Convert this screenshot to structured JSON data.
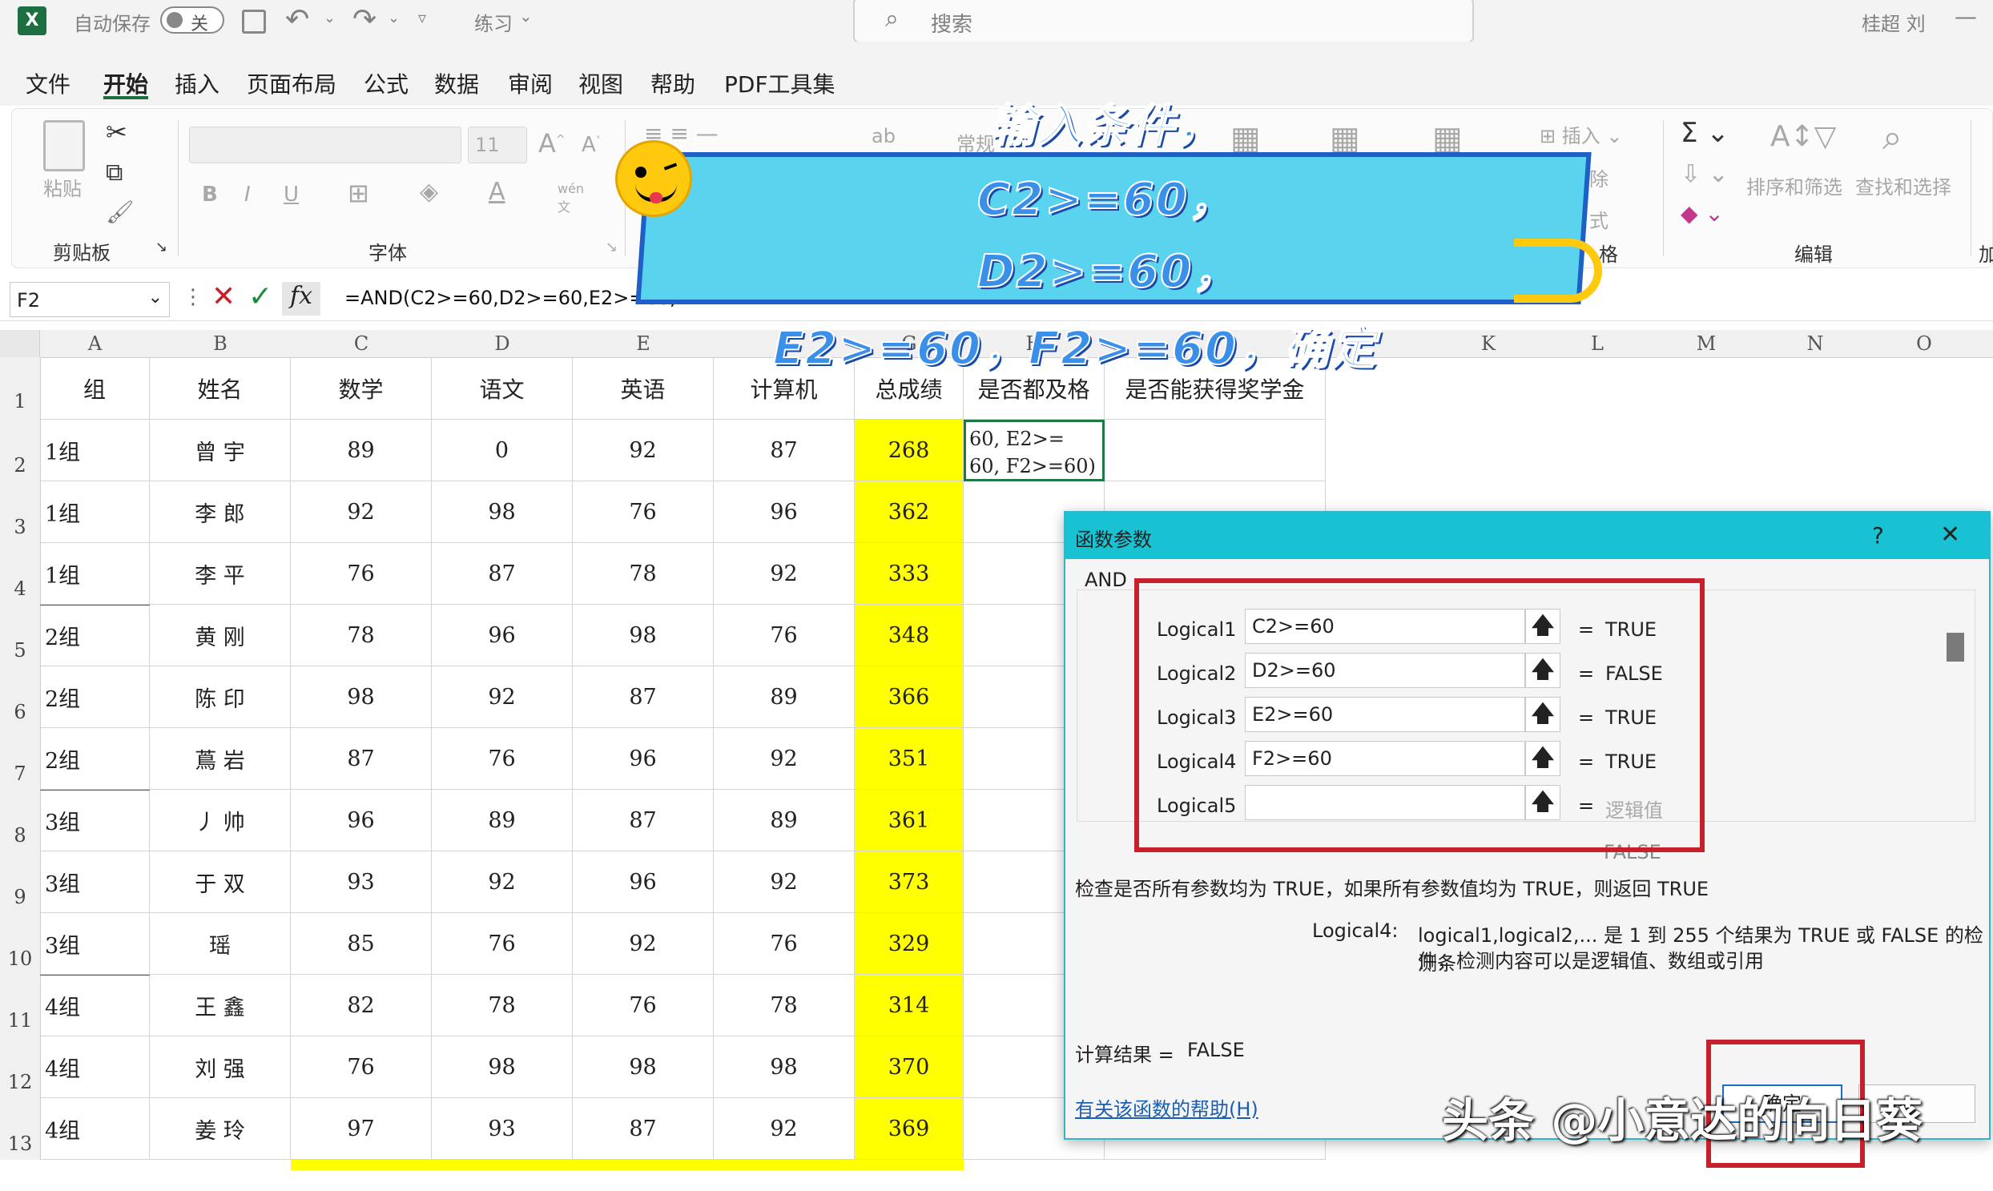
{
  "titlebar": {
    "autosave": "自动保存",
    "toggle": "关",
    "filename": "练习",
    "search_placeholder": "搜索",
    "user": "桂超 刘"
  },
  "menu": [
    "文件",
    "开始",
    "插入",
    "页面布局",
    "公式",
    "数据",
    "审阅",
    "视图",
    "帮助",
    "PDF工具集"
  ],
  "ribbon": {
    "paste": "粘贴",
    "clipboard": "剪贴板",
    "font_size": "11",
    "bold": "B",
    "italic": "I",
    "underline": "U",
    "font_group": "字体",
    "number_format": "常规",
    "insert": "插入",
    "delete": "除",
    "format": "式",
    "cells_group": "格",
    "sort_filter": "排序和筛选",
    "find_select": "查找和选择",
    "edit_group": "编辑",
    "add": "加"
  },
  "formula_bar": {
    "name_box": "F2",
    "fx": "fx",
    "formula": "=AND(C2>=60,D2>=60,E2>=60,"
  },
  "columns": [
    "A",
    "B",
    "C",
    "D",
    "E",
    "F",
    "G",
    "H",
    "I",
    "J",
    "K",
    "L",
    "M",
    "N",
    "O"
  ],
  "header_row": [
    "组",
    "姓名",
    "数学",
    "语文",
    "英语",
    "计算机",
    "总成绩",
    "是否都及格",
    "是否能获得奖学金"
  ],
  "rows": [
    {
      "n": "2",
      "group": "1组",
      "name": "曾 宇",
      "math": "89",
      "chinese": "0",
      "english": "92",
      "cs": "87",
      "total": "268"
    },
    {
      "n": "3",
      "group": "1组",
      "name": "李 郎",
      "math": "92",
      "chinese": "98",
      "english": "76",
      "cs": "96",
      "total": "362"
    },
    {
      "n": "4",
      "group": "1组",
      "name": "李 平",
      "math": "76",
      "chinese": "87",
      "english": "78",
      "cs": "92",
      "total": "333"
    },
    {
      "n": "5",
      "group": "2组",
      "name": "黄 刚",
      "math": "78",
      "chinese": "96",
      "english": "98",
      "cs": "76",
      "total": "348"
    },
    {
      "n": "6",
      "group": "2组",
      "name": "陈 印",
      "math": "98",
      "chinese": "92",
      "english": "87",
      "cs": "89",
      "total": "366"
    },
    {
      "n": "7",
      "group": "2组",
      "name": "蔦 岩",
      "math": "87",
      "chinese": "76",
      "english": "96",
      "cs": "92",
      "total": "351"
    },
    {
      "n": "8",
      "group": "3组",
      "name": "丿 帅",
      "math": "96",
      "chinese": "89",
      "english": "87",
      "cs": "89",
      "total": "361"
    },
    {
      "n": "9",
      "group": "3组",
      "name": "于 双",
      "math": "93",
      "chinese": "92",
      "english": "96",
      "cs": "92",
      "total": "373"
    },
    {
      "n": "10",
      "group": "3组",
      "name": "瑶",
      "math": "85",
      "chinese": "76",
      "english": "92",
      "cs": "76",
      "total": "329"
    },
    {
      "n": "11",
      "group": "4组",
      "name": "王 鑫",
      "math": "82",
      "chinese": "78",
      "english": "76",
      "cs": "78",
      "total": "314"
    },
    {
      "n": "12",
      "group": "4组",
      "name": "刘 强",
      "math": "76",
      "chinese": "98",
      "english": "98",
      "cs": "98",
      "total": "370"
    },
    {
      "n": "13",
      "group": "4组",
      "name": "姜 玲",
      "math": "97",
      "chinese": "93",
      "english": "87",
      "cs": "92",
      "total": "369"
    }
  ],
  "row1_num": "1",
  "h2_text": "60, E2>=\n60, F2>=60)",
  "dialog": {
    "title": "函数参数",
    "help_q": "?",
    "close": "✕",
    "func": "AND",
    "args": [
      {
        "label": "Logical1",
        "value": "C2>=60",
        "result": "TRUE"
      },
      {
        "label": "Logical2",
        "value": "D2>=60",
        "result": "FALSE"
      },
      {
        "label": "Logical3",
        "value": "E2>=60",
        "result": "TRUE"
      },
      {
        "label": "Logical4",
        "value": "F2>=60",
        "result": "TRUE"
      },
      {
        "label": "Logical5",
        "value": "",
        "result": "逻辑值"
      }
    ],
    "eq": "=",
    "overall": "FALSE",
    "description": "检查是否所有参数均为 TRUE，如果所有参数值均为 TRUE，则返回 TRUE",
    "arg_name": "Logical4:",
    "arg_desc1": "logical1,logical2,... 是 1 到 255 个结果为 TRUE 或 FALSE 的检测条",
    "arg_desc2": "件，检测内容可以是逻辑值、数组或引用",
    "result_label": "计算结果 =",
    "result_value": "FALSE",
    "help_link": "有关该函数的帮助(H)",
    "ok": "确定"
  },
  "banner": {
    "line0": "输入条件，",
    "line1": "C2>=60，",
    "line2": "D2>=60，",
    "line3": "E2>=60，F2>=60，确定"
  },
  "watermark": "头条 @小意达的向日葵"
}
